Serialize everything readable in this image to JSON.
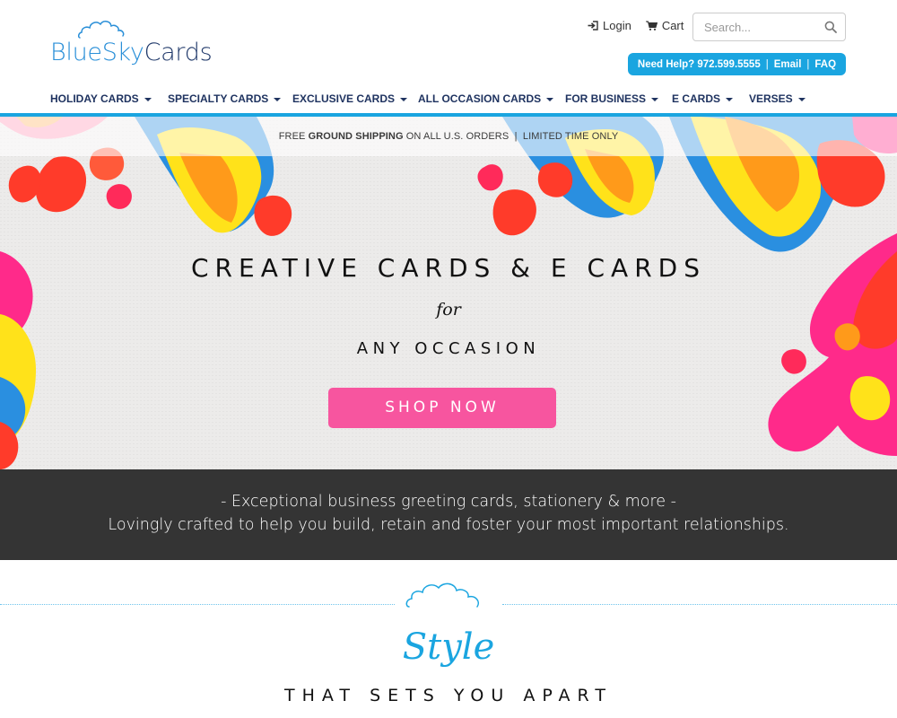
{
  "brand": {
    "logo_part1": "BlueSky",
    "logo_part2": "Cards",
    "colors": {
      "blue": "#1aa5e0",
      "navy": "#1f3360",
      "pink": "#f7559f",
      "dark_band": "#343434"
    },
    "logo_icon": "cloud-icon"
  },
  "header": {
    "login_label": "Login",
    "login_icon": "sign-in-icon",
    "cart_label": "Cart",
    "cart_icon": "cart-icon",
    "search_placeholder": "Search...",
    "search_icon": "search-icon",
    "help_label": "Need Help? 972.599.5555",
    "email_label": "Email",
    "faq_label": "FAQ",
    "separator": "|"
  },
  "nav": {
    "items": [
      {
        "label": "HOLIDAY CARDS"
      },
      {
        "label": "SPECIALTY CARDS"
      },
      {
        "label": "EXCLUSIVE CARDS"
      },
      {
        "label": "ALL OCCASION CARDS"
      },
      {
        "label": "FOR BUSINESS"
      },
      {
        "label": "E CARDS"
      },
      {
        "label": "VERSES"
      }
    ],
    "dropdown_icon": "caret-down-icon"
  },
  "promo": {
    "prefix": "FREE",
    "bold": "GROUND SHIPPING",
    "middle": "ON ALL U.S. ORDERS",
    "separator": "|",
    "suffix": "LIMITED TIME ONLY"
  },
  "hero": {
    "title": "CREATIVE CARDS & E CARDS",
    "for": "for",
    "subtitle": "ANY OCCASION",
    "cta": "SHOP NOW"
  },
  "band": {
    "line1": "- Exceptional business greeting cards, stationery & more -",
    "line2": "Lovingly crafted to help you build, retain and foster your most important relationships."
  },
  "style_section": {
    "script_word": "Style",
    "tagline": "THAT SETS YOU APART",
    "icon": "cloud-icon"
  }
}
